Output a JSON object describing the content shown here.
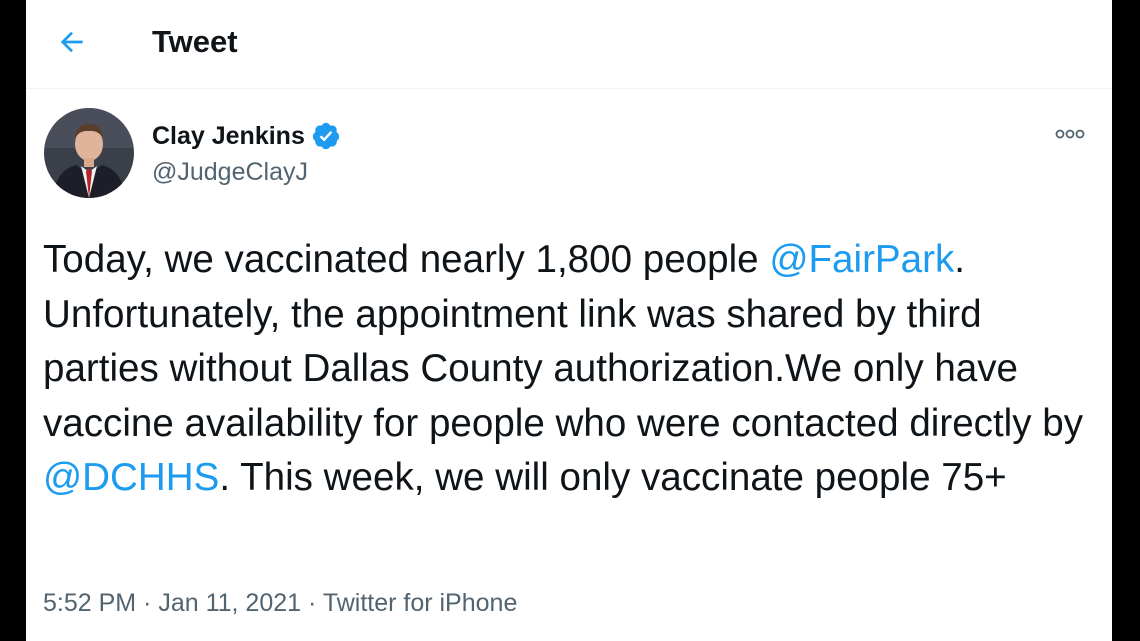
{
  "header": {
    "back_icon": "arrow-left-icon",
    "title": "Tweet"
  },
  "author": {
    "name": "Clay Jenkins",
    "handle": "@JudgeClayJ",
    "verified_icon": "verified-badge-icon",
    "avatar_icon": "avatar-photo"
  },
  "more_icon": "more-options-icon",
  "tweet": {
    "seg1": "Today, we vaccinated nearly 1,800 people ",
    "mention1": "@FairPark",
    "seg2": ". Unfortunately, the appointment link was shared by third parties without Dallas County authorization.We only have vaccine availability for people who were contacted directly by ",
    "mention2": "@DCHHS",
    "seg3": ". This week, we will only vaccinate people 75+"
  },
  "meta": {
    "time": "5:52 PM",
    "sep1": " · ",
    "date": "Jan 11, 2021",
    "sep2": " · ",
    "source": "Twitter for iPhone"
  },
  "colors": {
    "accent": "#1d9bf0",
    "text": "#0f1419",
    "secondary": "#536471",
    "frame": "#000000"
  }
}
